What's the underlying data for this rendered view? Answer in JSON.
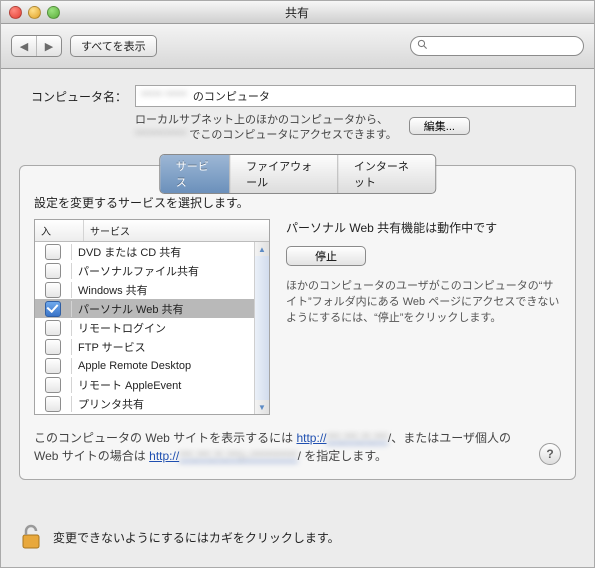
{
  "title": "共有",
  "toolbar": {
    "show_all": "すべてを表示",
    "search_placeholder": ""
  },
  "computer_name": {
    "label": "コンピュータ名：",
    "value_prefix_obscured": "***** *****",
    "value_suffix": " のコンピュータ",
    "sub1": "ローカルサブネット上のほかのコンピュータから、",
    "sub2_obscured": "************",
    "sub2b": " でこのコンピュータにアクセスできます。",
    "edit": "編集..."
  },
  "tabs": [
    "サービス",
    "ファイアウォール",
    "インターネット"
  ],
  "panel_heading": "設定を変更するサービスを選択します。",
  "columns": {
    "on": "入",
    "service": "サービス"
  },
  "services": [
    {
      "on": false,
      "label": "DVD または CD 共有"
    },
    {
      "on": false,
      "label": "パーソナルファイル共有"
    },
    {
      "on": false,
      "label": "Windows 共有"
    },
    {
      "on": true,
      "label": "パーソナル Web 共有"
    },
    {
      "on": false,
      "label": "リモートログイン"
    },
    {
      "on": false,
      "label": "FTP サービス"
    },
    {
      "on": false,
      "label": "Apple Remote Desktop"
    },
    {
      "on": false,
      "label": "リモート AppleEvent"
    },
    {
      "on": false,
      "label": "プリンタ共有"
    }
  ],
  "status": "パーソナル Web 共有機能は動作中です",
  "stop_label": "停止",
  "desc": "ほかのコンピュータのユーザがこのコンピュータの“サイト”フォルダ内にある Web ページにアクセスできないようにするには、“停止”をクリックします。",
  "footer": {
    "a": "このコンピュータの Web サイトを表示するには ",
    "link1_prefix": "http://",
    "link1_obscured": "***.***.**.***",
    "b": "/、またはユーザ個人の Web サイトの場合は ",
    "link2_prefix": "http://",
    "link2_obscured": "***.***.**.***/~**********",
    "c": "/ を指定します。"
  },
  "lock_text": "変更できないようにするにはカギをクリックします。"
}
